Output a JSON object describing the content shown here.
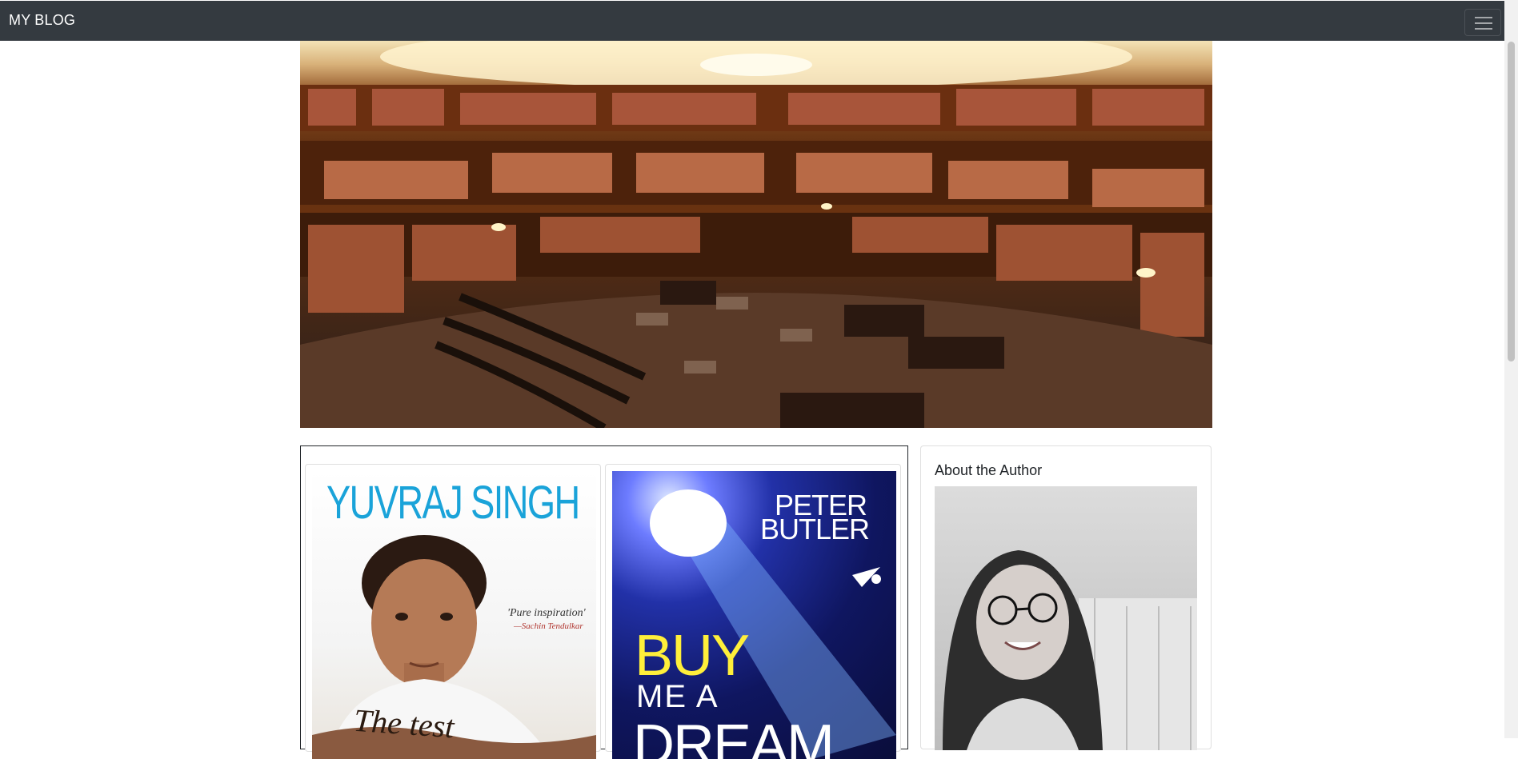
{
  "navbar": {
    "brand": "MY BLOG",
    "toggler_icon": "hamburger-menu-icon",
    "background": "#343a40"
  },
  "hero": {
    "image": "library-interior-panorama"
  },
  "posts": {
    "cards": [
      {
        "cover": {
          "title": "YUVRAJ SINGH",
          "quote": "'Pure inspiration'",
          "quote_by": "—Sachin Tendulkar",
          "subtitle": "The test"
        }
      },
      {
        "cover": {
          "author_line1": "PETER",
          "author_line2": "BUTLER",
          "title_word1": "BUY",
          "title_word2": "ME A",
          "title_word3": "DREAM"
        }
      }
    ]
  },
  "sidebar": {
    "about_title": "About the Author",
    "author_image": "author-photo"
  }
}
